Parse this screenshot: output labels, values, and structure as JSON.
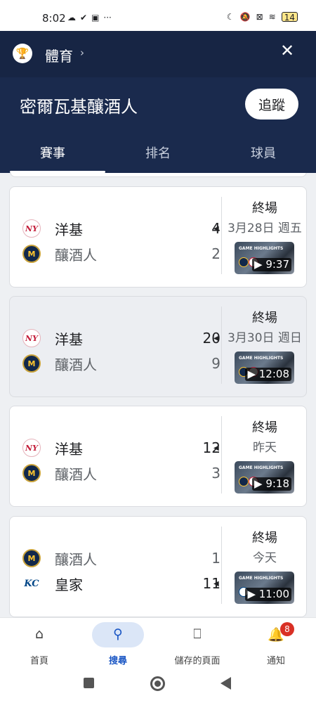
{
  "status_bar": {
    "time": "8:02",
    "left_icons": [
      "cloud-icon",
      "check-circle-icon",
      "briefcase-icon",
      "more-icon"
    ],
    "right_icons": [
      "moon-icon",
      "mute-icon",
      "no-sim-icon",
      "wifi-icon"
    ],
    "battery": "14"
  },
  "header": {
    "sport_icon": "trophy-icon",
    "sport_title": "體育",
    "sport_chevron": "›",
    "close_symbol": "✕",
    "team_title": "密爾瓦基釀酒人",
    "follow_label": "追蹤",
    "tabs": [
      {
        "label": "賽事",
        "active": true
      },
      {
        "label": "排名",
        "active": false
      },
      {
        "label": "球員",
        "active": false
      }
    ]
  },
  "games": [
    {
      "teams": [
        {
          "logo": "yankees-logo-icon",
          "name": "洋基",
          "score": "4",
          "winner": true
        },
        {
          "logo": "brewers-logo-icon",
          "name": "釀酒人",
          "score": "2",
          "winner": false
        }
      ],
      "status": "終場",
      "date": "3月28日 週五",
      "highlight_label": "GAME HIGHLIGHTS",
      "duration": "9:37"
    },
    {
      "teams": [
        {
          "logo": "yankees-logo-icon",
          "name": "洋基",
          "score": "20",
          "winner": true
        },
        {
          "logo": "brewers-logo-icon",
          "name": "釀酒人",
          "score": "9",
          "winner": false
        }
      ],
      "status": "終場",
      "date": "3月30日 週日",
      "highlight_label": "GAME HIGHLIGHTS",
      "duration": "12:08"
    },
    {
      "teams": [
        {
          "logo": "yankees-logo-icon",
          "name": "洋基",
          "score": "12",
          "winner": true
        },
        {
          "logo": "brewers-logo-icon",
          "name": "釀酒人",
          "score": "3",
          "winner": false
        }
      ],
      "status": "終場",
      "date": "昨天",
      "highlight_label": "GAME HIGHLIGHTS",
      "duration": "9:18"
    },
    {
      "teams": [
        {
          "logo": "brewers-logo-icon",
          "name": "釀酒人",
          "score": "1",
          "winner": false
        },
        {
          "logo": "royals-logo-icon",
          "name": "皇家",
          "score": "11",
          "winner": true
        }
      ],
      "status": "終場",
      "date": "今天",
      "highlight_label": "GAME HIGHLIGHTS",
      "duration": "11:00"
    }
  ],
  "bottom_nav": [
    {
      "icon": "home-icon",
      "label": "首頁",
      "active": false
    },
    {
      "icon": "search-icon",
      "label": "搜尋",
      "active": true
    },
    {
      "icon": "bookmark-icon",
      "label": "儲存的頁面",
      "active": false
    },
    {
      "icon": "bell-icon",
      "label": "通知",
      "active": false,
      "badge": "8"
    }
  ],
  "colors": {
    "header_bg": "#1a2a4d",
    "accent": "#1a56c4",
    "badge": "#d93025"
  }
}
